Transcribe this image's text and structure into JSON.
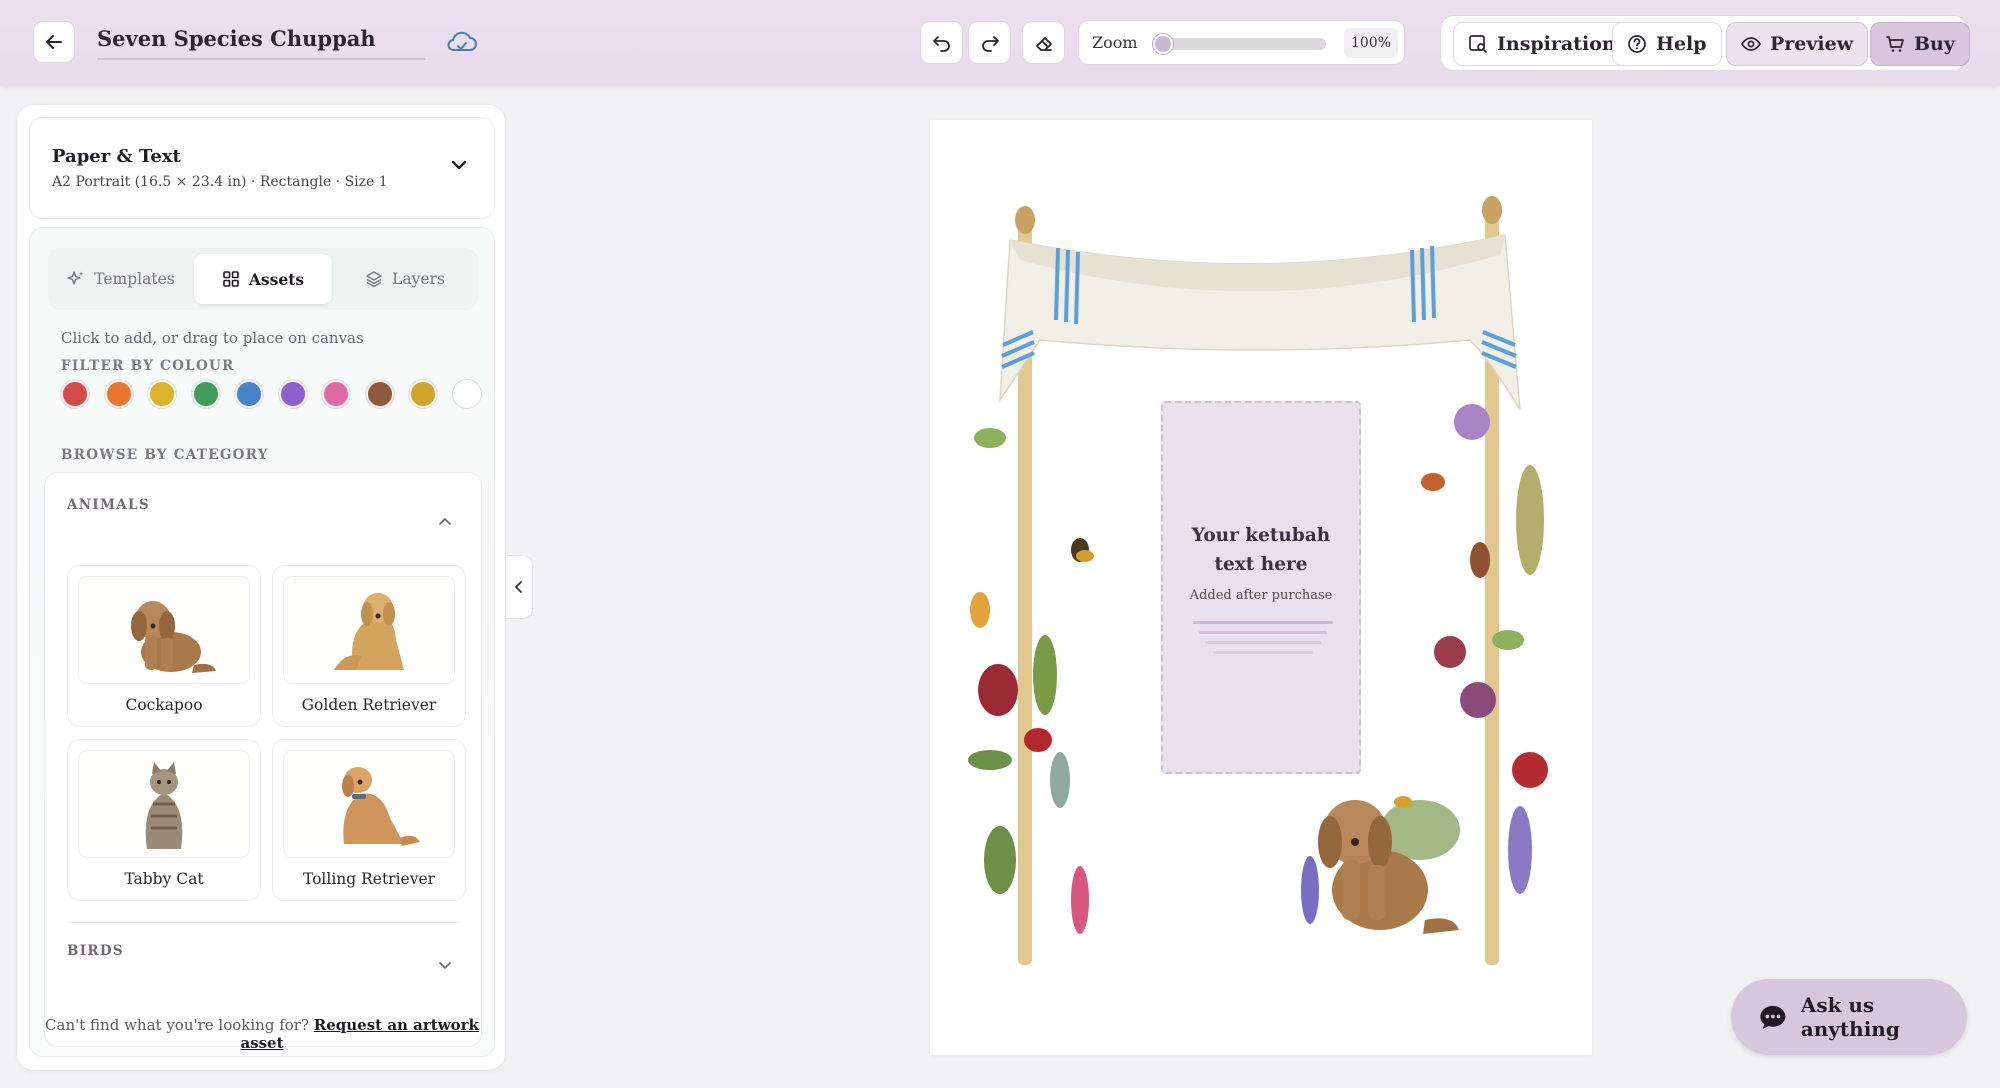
{
  "header": {
    "document_title": "Seven Species Chuppah",
    "zoom_label": "Zoom",
    "zoom_value": "100%",
    "zoom_level_fraction": 0.0,
    "buttons": {
      "inspiration": "Inspiration",
      "help": "Help",
      "preview": "Preview",
      "buy": "Buy"
    }
  },
  "panel": {
    "paper": {
      "title": "Paper & Text",
      "subtitle": "A2 Portrait (16.5 × 23.4 in) · Rectangle · Size 1"
    },
    "tabs": [
      {
        "label": "Templates",
        "active": false
      },
      {
        "label": "Assets",
        "active": true
      },
      {
        "label": "Layers",
        "active": false
      }
    ],
    "hint": "Click to add, or drag to place on canvas",
    "filter_label": "FILTER BY COLOUR",
    "colour_swatches": [
      "#d24d4a",
      "#e5782e",
      "#dab22b",
      "#3f9a5c",
      "#4a83c5",
      "#8f5fcb",
      "#dd6aa7",
      "#8d5a3b",
      "#cfa42a",
      "#ffffff"
    ],
    "browse_label": "BROWSE BY CATEGORY",
    "categories": [
      {
        "name": "ANIMALS",
        "expanded": true,
        "items": [
          {
            "name": "Cockapoo"
          },
          {
            "name": "Golden Retriever"
          },
          {
            "name": "Tabby Cat"
          },
          {
            "name": "Tolling Retriever"
          }
        ]
      },
      {
        "name": "BIRDS",
        "expanded": false
      }
    ],
    "footer_prefix": "Can't find what you're looking for?",
    "footer_link": "Request an artwork asset"
  },
  "canvas": {
    "text_placeholder_title": "Your ketubah text here",
    "text_placeholder_sub": "Added after purchase"
  },
  "chat": {
    "label": "Ask us anything"
  },
  "colors": {
    "accent": "#d6c7dd",
    "header_bg": "#ecdfee",
    "canvas_bg": "#f2f1f3"
  }
}
